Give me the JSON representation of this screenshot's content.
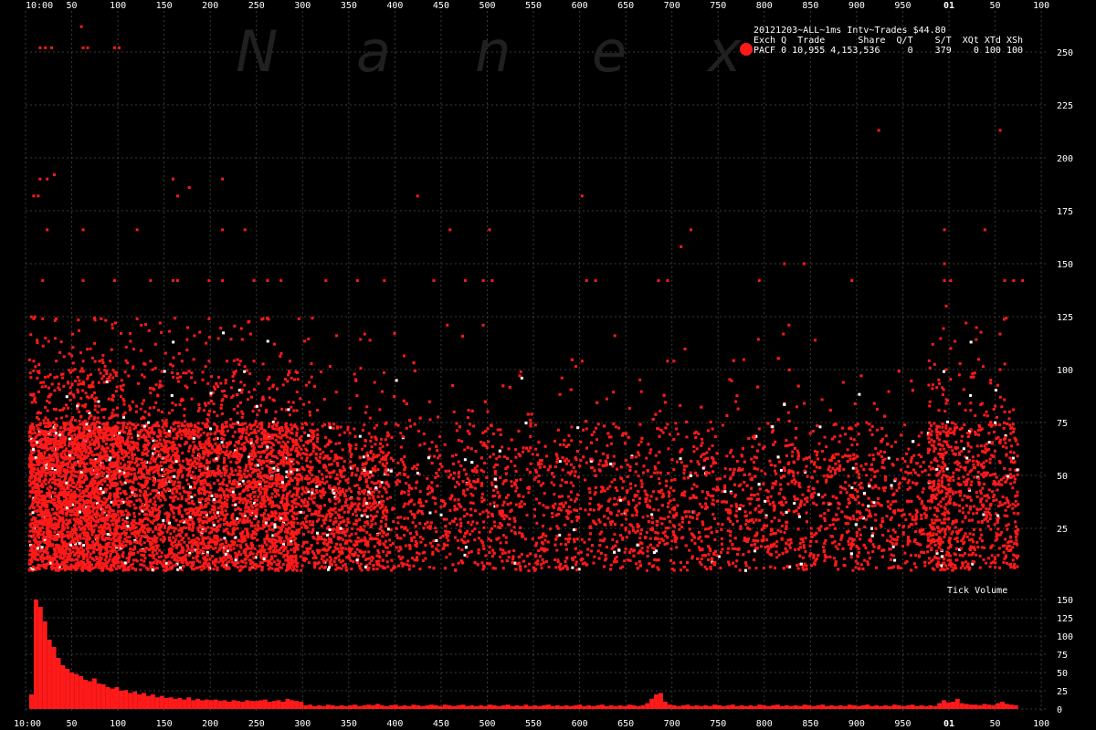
{
  "watermark": [
    "N",
    "a",
    "n",
    "e",
    "x"
  ],
  "legend": {
    "title": "20121203~ALL~1ms Intv~Trades $44.80",
    "header": "Exch Q  Trade      Share  Q/T    S/T  XQt XTd XSh",
    "row": "PACF 0 10,955 4,153,536     0    379    0 100 100",
    "dot_color": "#ff1a1a"
  },
  "volume_label": "Tick Volume",
  "colors": {
    "background": "#000000",
    "grid": "#3a3a3a",
    "points": "#ff1a1a",
    "axis_text": "#ffffff"
  },
  "chart_data": [
    {
      "type": "scatter",
      "title": "",
      "xlabel": "",
      "ylabel": "",
      "x_tick_labels": [
        "10:00",
        "50",
        "100",
        "150",
        "200",
        "250",
        "300",
        "350",
        "400",
        "450",
        "500",
        "550",
        "600",
        "650",
        "700",
        "750",
        "800",
        "850",
        "900",
        "950",
        "01",
        "50",
        "100"
      ],
      "ylim": [
        0,
        260
      ],
      "y_ticks": [
        25,
        50,
        75,
        100,
        125,
        150,
        175,
        200,
        225,
        250
      ],
      "grid": true,
      "density_profile": {
        "x_ranges_ms": [
          [
            0,
            100
          ],
          [
            100,
            300
          ],
          [
            300,
            400
          ],
          [
            400,
            1000
          ],
          [
            1000,
            1025
          ],
          [
            1025,
            1100
          ]
        ],
        "relative_density": [
          1.0,
          0.6,
          0.35,
          0.2,
          0.45,
          0.25
        ]
      },
      "points": [
        [
          12,
          252
        ],
        [
          18,
          252
        ],
        [
          25,
          252
        ],
        [
          60,
          252
        ],
        [
          65,
          252
        ],
        [
          95,
          252
        ],
        [
          100,
          252
        ],
        [
          58,
          262
        ],
        [
          12,
          190
        ],
        [
          20,
          190
        ],
        [
          28,
          192
        ],
        [
          160,
          190
        ],
        [
          165,
          182
        ],
        [
          178,
          186
        ],
        [
          215,
          190
        ],
        [
          5,
          182
        ],
        [
          10,
          182
        ],
        [
          945,
          213
        ],
        [
          1080,
          213
        ],
        [
          615,
          182
        ],
        [
          432,
          182
        ],
        [
          20,
          166
        ],
        [
          60,
          166
        ],
        [
          120,
          166
        ],
        [
          215,
          166
        ],
        [
          240,
          166
        ],
        [
          468,
          166
        ],
        [
          512,
          166
        ],
        [
          736,
          166
        ],
        [
          1018,
          166
        ],
        [
          1063,
          166
        ],
        [
          15,
          142
        ],
        [
          60,
          142
        ],
        [
          95,
          142
        ],
        [
          135,
          142
        ],
        [
          160,
          142
        ],
        [
          165,
          142
        ],
        [
          200,
          142
        ],
        [
          215,
          142
        ],
        [
          250,
          142
        ],
        [
          265,
          142
        ],
        [
          280,
          142
        ],
        [
          330,
          142
        ],
        [
          365,
          142
        ],
        [
          395,
          142
        ],
        [
          450,
          142
        ],
        [
          485,
          142
        ],
        [
          505,
          142
        ],
        [
          515,
          142
        ],
        [
          620,
          142
        ],
        [
          630,
          142
        ],
        [
          700,
          142
        ],
        [
          710,
          142
        ],
        [
          812,
          142
        ],
        [
          915,
          142
        ],
        [
          1018,
          142
        ],
        [
          1025,
          142
        ],
        [
          1085,
          142
        ],
        [
          1095,
          142
        ],
        [
          1105,
          142
        ],
        [
          5,
          124
        ],
        [
          15,
          124
        ],
        [
          30,
          124
        ],
        [
          80,
          124
        ],
        [
          120,
          124
        ],
        [
          200,
          124
        ],
        [
          260,
          124
        ],
        [
          300,
          124
        ],
        [
          465,
          121
        ],
        [
          505,
          121
        ],
        [
          845,
          121
        ],
        [
          5,
          104
        ],
        [
          30,
          104
        ],
        [
          60,
          104
        ],
        [
          90,
          104
        ],
        [
          135,
          104
        ],
        [
          170,
          104
        ],
        [
          200,
          104
        ],
        [
          220,
          104
        ],
        [
          235,
          104
        ],
        [
          250,
          104
        ],
        [
          290,
          104
        ],
        [
          615,
          104
        ],
        [
          710,
          104
        ],
        [
          717,
          104
        ],
        [
          1018,
          150
        ],
        [
          840,
          150
        ],
        [
          862,
          150
        ],
        [
          725,
          158
        ],
        [
          1020,
          130
        ],
        [
          1025,
          110
        ],
        [
          1020,
          100
        ],
        [
          1080,
          100
        ],
        [
          840,
          84
        ],
        [
          862,
          84
        ],
        [
          940,
          84
        ],
        [
          1020,
          84
        ],
        [
          1060,
          84
        ],
        [
          1085,
          80
        ],
        [
          510,
          72
        ],
        [
          620,
          72
        ],
        [
          700,
          72
        ],
        [
          720,
          72
        ],
        [
          760,
          72
        ],
        [
          805,
          68
        ],
        [
          812,
          72
        ],
        [
          915,
          72
        ],
        [
          1030,
          72
        ],
        [
          1060,
          72
        ],
        [
          560,
          60
        ],
        [
          620,
          56
        ],
        [
          700,
          56
        ],
        [
          760,
          64
        ],
        [
          845,
          56
        ],
        [
          900,
          60
        ],
        [
          945,
          60
        ],
        [
          1030,
          56
        ],
        [
          1080,
          56
        ],
        [
          430,
          44
        ],
        [
          470,
          40
        ],
        [
          520,
          44
        ],
        [
          600,
          40
        ],
        [
          660,
          44
        ],
        [
          720,
          32
        ],
        [
          745,
          32
        ],
        [
          785,
          40
        ],
        [
          825,
          40
        ],
        [
          870,
          40
        ],
        [
          905,
          44
        ],
        [
          950,
          44
        ],
        [
          1020,
          40
        ],
        [
          1060,
          36
        ],
        [
          1100,
          32
        ],
        [
          520,
          20
        ],
        [
          560,
          20
        ],
        [
          600,
          20
        ],
        [
          640,
          20
        ],
        [
          700,
          20
        ],
        [
          720,
          16
        ],
        [
          745,
          16
        ],
        [
          800,
          20
        ],
        [
          860,
          20
        ],
        [
          915,
          20
        ],
        [
          960,
          20
        ],
        [
          1030,
          20
        ],
        [
          1060,
          16
        ],
        [
          1100,
          12
        ]
      ]
    },
    {
      "type": "bar",
      "title": "Tick Volume",
      "xlabel": "",
      "ylabel": "",
      "ylim": [
        0,
        160
      ],
      "y_ticks": [
        0,
        25,
        50,
        75,
        100,
        125,
        150
      ],
      "grid": true,
      "bin_ms": 5,
      "values": [
        20,
        150,
        140,
        120,
        95,
        85,
        70,
        60,
        55,
        50,
        48,
        45,
        40,
        38,
        42,
        35,
        34,
        30,
        28,
        30,
        25,
        26,
        22,
        24,
        20,
        22,
        18,
        20,
        16,
        18,
        15,
        16,
        14,
        15,
        13,
        16,
        12,
        14,
        12,
        13,
        12,
        13,
        11,
        12,
        10,
        12,
        11,
        10,
        12,
        11,
        11,
        12,
        13,
        10,
        11,
        12,
        10,
        14,
        12,
        11,
        10,
        5,
        6,
        4,
        5,
        4,
        6,
        5,
        4,
        5,
        4,
        5,
        6,
        4,
        5,
        6,
        5,
        7,
        5,
        4,
        5,
        6,
        4,
        5,
        4,
        6,
        5,
        4,
        5,
        6,
        5,
        4,
        6,
        5,
        4,
        5,
        6,
        4,
        5,
        4,
        5,
        4,
        6,
        5,
        4,
        5,
        6,
        4,
        5,
        4,
        6,
        4,
        5,
        4,
        5,
        6,
        4,
        5,
        4,
        5,
        4,
        5,
        6,
        4,
        5,
        4,
        5,
        6,
        4,
        5,
        4,
        5,
        4,
        6,
        5,
        4,
        5,
        8,
        14,
        20,
        22,
        10,
        6,
        5,
        4,
        5,
        6,
        4,
        5,
        4,
        5,
        4,
        6,
        5,
        4,
        5,
        6,
        4,
        5,
        4,
        5,
        4,
        6,
        5,
        4,
        5,
        6,
        4,
        5,
        4,
        5,
        4,
        6,
        5,
        4,
        5,
        6,
        4,
        5,
        4,
        5,
        4,
        6,
        5,
        4,
        5,
        6,
        4,
        5,
        4,
        5,
        4,
        6,
        5,
        4,
        5,
        6,
        4,
        5,
        4,
        5,
        4,
        8,
        12,
        9,
        10,
        14,
        8,
        7,
        6,
        6,
        5,
        7,
        6,
        5,
        8,
        10,
        7,
        6,
        5
      ]
    }
  ]
}
